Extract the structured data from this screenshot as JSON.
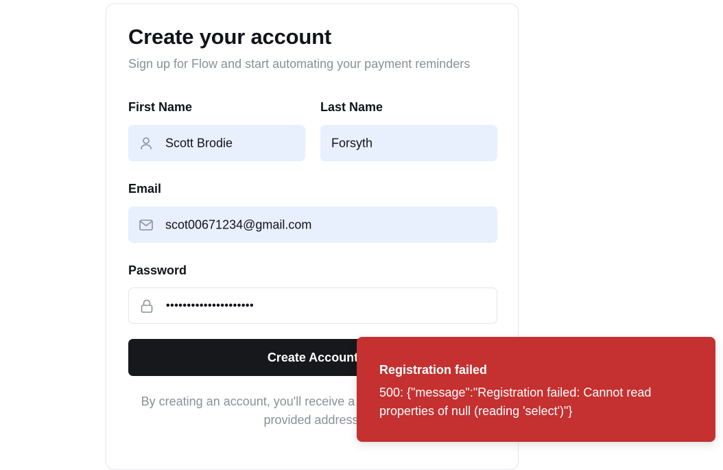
{
  "form": {
    "title": "Create your account",
    "subtitle": "Sign up for Flow and start automating your payment reminders",
    "first_name": {
      "label": "First Name",
      "value": "Scott Brodie",
      "icon": "user-icon"
    },
    "last_name": {
      "label": "Last Name",
      "value": "Forsyth"
    },
    "email": {
      "label": "Email",
      "value": "scot00671234@gmail.com",
      "icon": "mail-icon"
    },
    "password": {
      "label": "Password",
      "value": "•••••••••••••••••••••",
      "icon": "lock-icon"
    },
    "submit_label": "Create Account",
    "fineprint": "By creating an account, you'll receive a verification email at the provided address."
  },
  "toast": {
    "title": "Registration failed",
    "message": "500: {\"message\":\"Registration failed: Cannot read properties of null (reading 'select')\"}",
    "color": "#c53030"
  },
  "colors": {
    "autofill_bg": "#e8f0fe",
    "button_bg": "#17181b",
    "muted_text": "#8a8f98"
  }
}
